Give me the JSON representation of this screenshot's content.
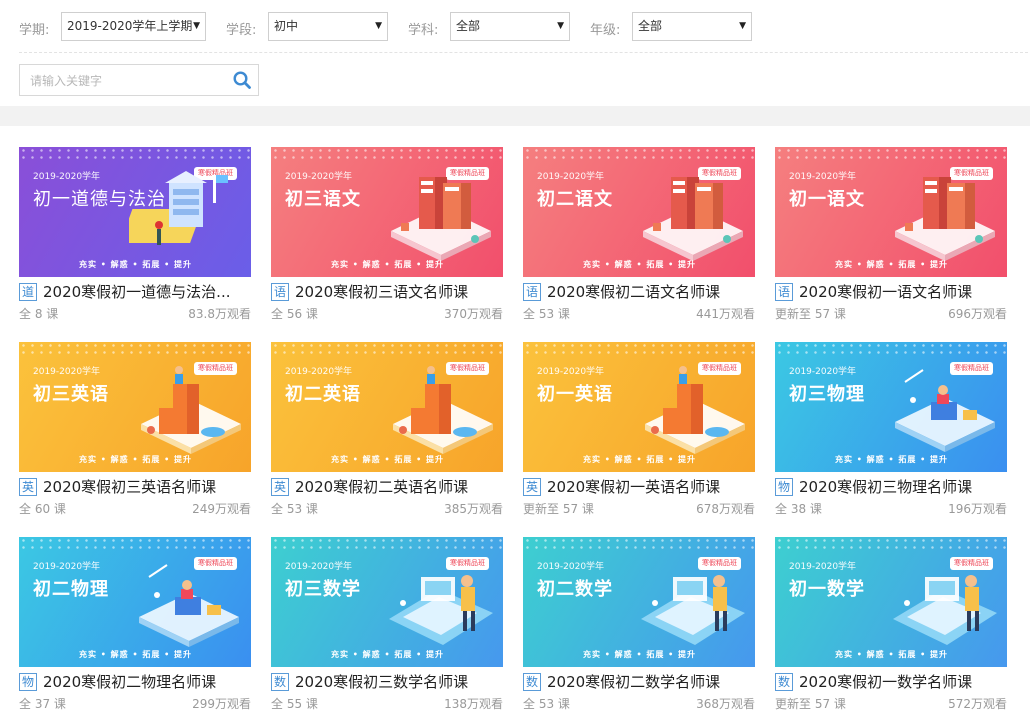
{
  "filters": {
    "term": {
      "label": "学期:",
      "value": "2019-2020学年上学期"
    },
    "stage": {
      "label": "学段:",
      "value": "初中"
    },
    "subject": {
      "label": "学科:",
      "value": "全部"
    },
    "grade": {
      "label": "年级:",
      "value": "全部"
    }
  },
  "search": {
    "placeholder": "请输入关键字"
  },
  "thumb_common": {
    "year": "2019-2020学年",
    "tag": "寒假精品班",
    "slogan": "充实 • 解惑 • 拓展 • 提升"
  },
  "courses": [
    {
      "thumb_title": "初一道德与法治",
      "subject_char": "道",
      "title": "2020寒假初一道德与法治...",
      "lessons": "全 8 课",
      "views": "83.8万观看",
      "theme": "purple"
    },
    {
      "thumb_title": "初三语文",
      "subject_char": "语",
      "title": "2020寒假初三语文名师课",
      "lessons": "全 56 课",
      "views": "370万观看",
      "theme": "red"
    },
    {
      "thumb_title": "初二语文",
      "subject_char": "语",
      "title": "2020寒假初二语文名师课",
      "lessons": "全 53 课",
      "views": "441万观看",
      "theme": "red"
    },
    {
      "thumb_title": "初一语文",
      "subject_char": "语",
      "title": "2020寒假初一语文名师课",
      "lessons": "更新至 57 课",
      "views": "696万观看",
      "theme": "red"
    },
    {
      "thumb_title": "初三英语",
      "subject_char": "英",
      "title": "2020寒假初三英语名师课",
      "lessons": "全 60 课",
      "views": "249万观看",
      "theme": "orange"
    },
    {
      "thumb_title": "初二英语",
      "subject_char": "英",
      "title": "2020寒假初二英语名师课",
      "lessons": "全 53 课",
      "views": "385万观看",
      "theme": "orange"
    },
    {
      "thumb_title": "初一英语",
      "subject_char": "英",
      "title": "2020寒假初一英语名师课",
      "lessons": "更新至 57 课",
      "views": "678万观看",
      "theme": "orange"
    },
    {
      "thumb_title": "初三物理",
      "subject_char": "物",
      "title": "2020寒假初三物理名师课",
      "lessons": "全 38 课",
      "views": "196万观看",
      "theme": "blue"
    },
    {
      "thumb_title": "初二物理",
      "subject_char": "物",
      "title": "2020寒假初二物理名师课",
      "lessons": "全 37 课",
      "views": "299万观看",
      "theme": "blue"
    },
    {
      "thumb_title": "初三数学",
      "subject_char": "数",
      "title": "2020寒假初三数学名师课",
      "lessons": "全 55 课",
      "views": "138万观看",
      "theme": "teal"
    },
    {
      "thumb_title": "初二数学",
      "subject_char": "数",
      "title": "2020寒假初二数学名师课",
      "lessons": "全 53 课",
      "views": "368万观看",
      "theme": "teal"
    },
    {
      "thumb_title": "初一数学",
      "subject_char": "数",
      "title": "2020寒假初一数学名师课",
      "lessons": "更新至 57 课",
      "views": "572万观看",
      "theme": "teal"
    }
  ],
  "theme_colors": {
    "purple": [
      "#8a4fd8",
      "#6a5ee8"
    ],
    "red": [
      "#f57f7f",
      "#f24f6c"
    ],
    "orange": [
      "#fbc23c",
      "#f7a42a"
    ],
    "blue": [
      "#3bc8e3",
      "#3a8ff0"
    ],
    "teal": [
      "#3dcfd0",
      "#4698ee"
    ]
  },
  "accent_color": "#3d8ad2"
}
